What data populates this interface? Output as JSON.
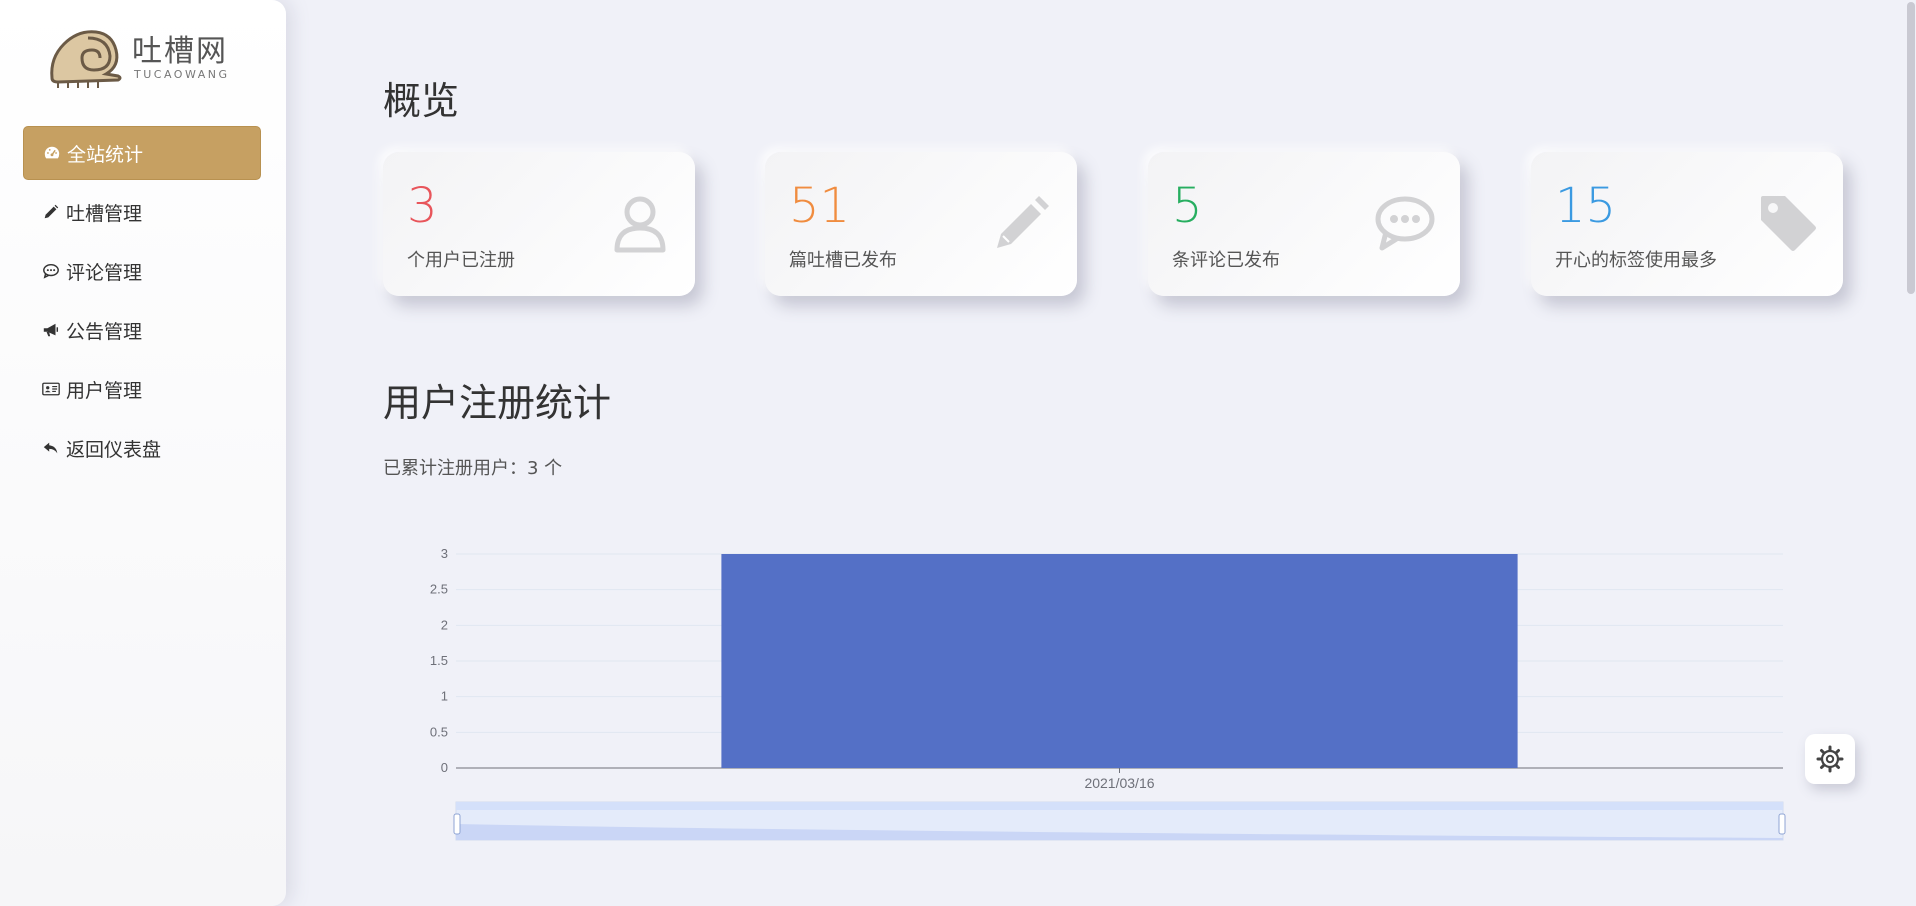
{
  "logo": {
    "title": "吐槽网",
    "subtitle": "TUCAOWANG"
  },
  "sidebar": {
    "items": [
      {
        "label": "全站统计",
        "icon": "dashboard-icon",
        "active": true
      },
      {
        "label": "吐槽管理",
        "icon": "pencil-icon"
      },
      {
        "label": "评论管理",
        "icon": "comment-icon"
      },
      {
        "label": "公告管理",
        "icon": "bullhorn-icon"
      },
      {
        "label": "用户管理",
        "icon": "id-card-icon"
      },
      {
        "label": "返回仪表盘",
        "icon": "reply-icon"
      }
    ]
  },
  "overview": {
    "title": "概览",
    "cards": [
      {
        "value": "3",
        "label": "个用户已注册",
        "color": "#e8555b",
        "icon": "user-icon"
      },
      {
        "value": "51",
        "label": "篇吐槽已发布",
        "color": "#f08c3f",
        "icon": "pencil-icon"
      },
      {
        "value": "5",
        "label": "条评论已发布",
        "color": "#27ae60",
        "icon": "comment-icon"
      },
      {
        "value": "15",
        "label": "开心的标签使用最多",
        "color": "#3b9ae1",
        "icon": "tag-icon"
      }
    ]
  },
  "registration": {
    "title": "用户注册统计",
    "summary": "已累计注册用户：3 个"
  },
  "chart_data": {
    "type": "bar",
    "categories": [
      "2021/03/16"
    ],
    "values": [
      3
    ],
    "ylim": [
      0,
      3
    ],
    "yticks": [
      "0",
      "0.5",
      "1",
      "1.5",
      "2",
      "2.5",
      "3"
    ],
    "grid": true,
    "bar_color": "#5470c6",
    "has_datazoom": true
  },
  "tools": {
    "settings_icon": "gear-icon"
  }
}
